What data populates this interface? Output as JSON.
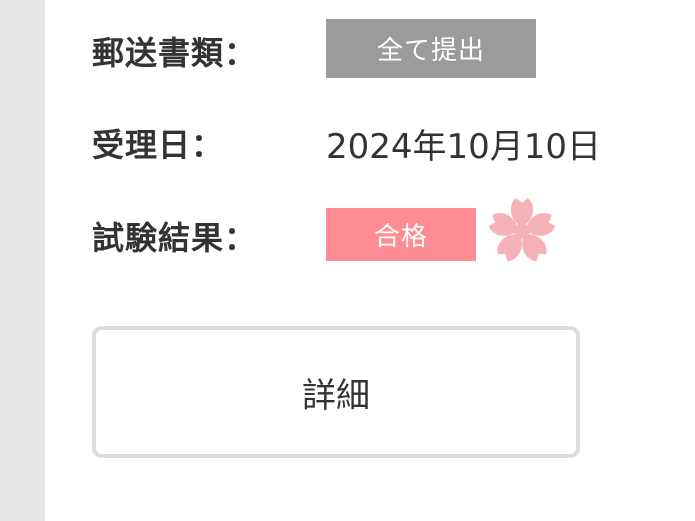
{
  "rows": {
    "mail_documents": {
      "label": "郵送書類：",
      "badge": "全て提出"
    },
    "received_date": {
      "label": "受理日：",
      "value": "2024年10月10日"
    },
    "exam_result": {
      "label": "試験結果：",
      "badge": "合格"
    }
  },
  "actions": {
    "detail_label": "詳細"
  },
  "icons": {
    "result_icon": "sakura-icon"
  },
  "colors": {
    "mail_badge": "#9b9b9b",
    "result_badge": "#ff8c94",
    "sakura": "#f5b3b8"
  }
}
